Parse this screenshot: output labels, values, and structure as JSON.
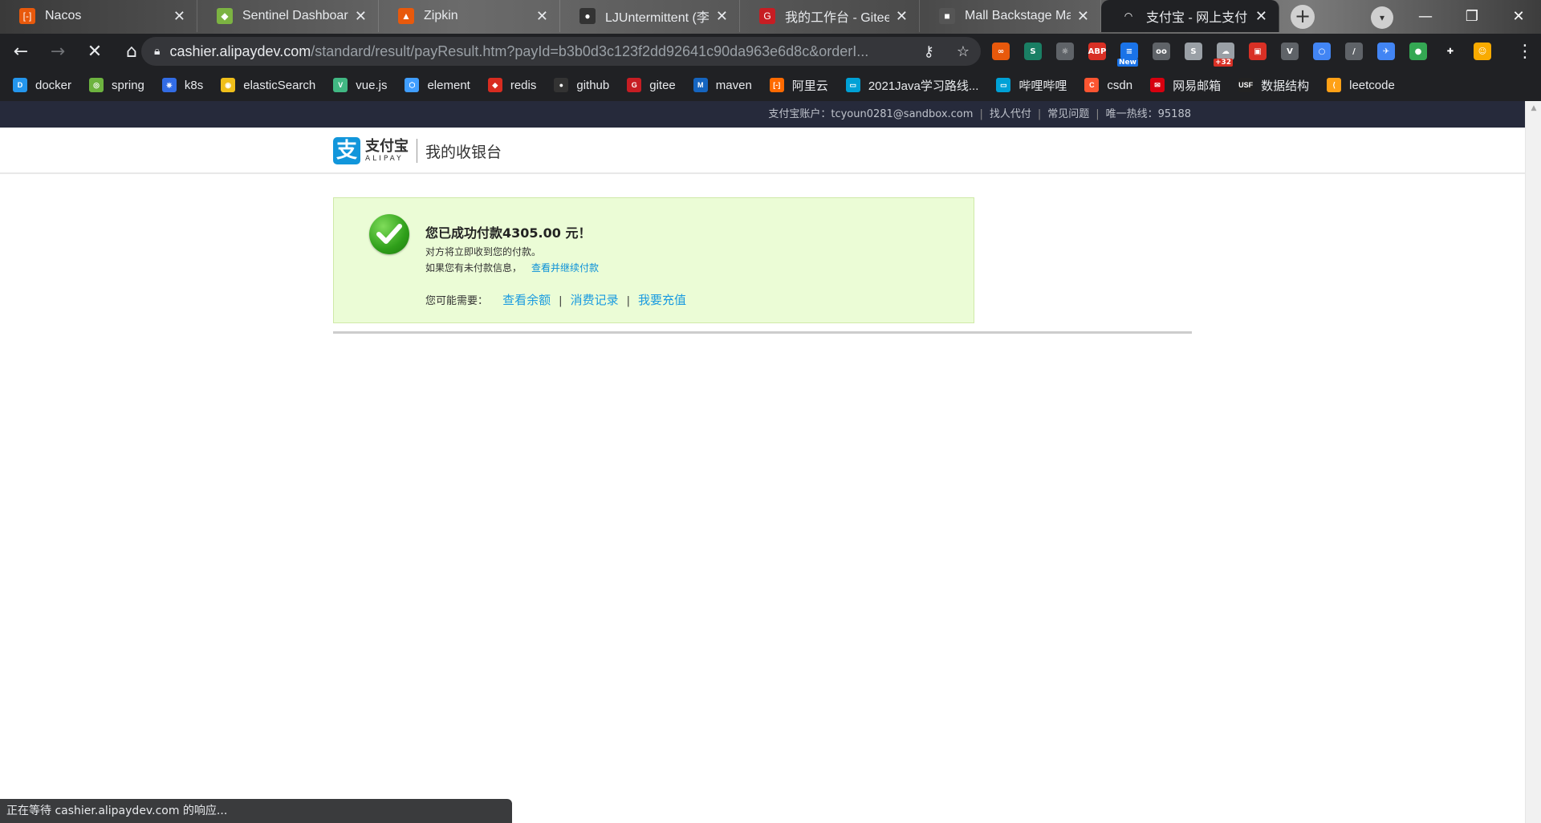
{
  "tabs": [
    {
      "title": "Nacos",
      "fav_color": "#e8590c",
      "fav_glyph": "[-]"
    },
    {
      "title": "Sentinel Dashboard",
      "fav_color": "#7cb342",
      "fav_glyph": "◆"
    },
    {
      "title": "Zipkin",
      "fav_color": "#e8590c",
      "fav_glyph": "▲"
    },
    {
      "title": "LJUntermittent (李佳",
      "fav_color": "#333333",
      "fav_glyph": "●"
    },
    {
      "title": "我的工作台 - Gitee.co",
      "fav_color": "#c71d23",
      "fav_glyph": "G"
    },
    {
      "title": "Mall Backstage Ma",
      "fav_color": "#555555",
      "fav_glyph": "■"
    },
    {
      "title": "支付宝 - 网上支付 安",
      "fav_color": "#202124",
      "fav_glyph": "◠"
    }
  ],
  "address": {
    "host": "cashier.alipaydev.com",
    "path": "/standard/result/payResult.htm?payId=b3b0d3c123f2dd92641c90da963e6d8c&orderI..."
  },
  "extensions": [
    {
      "name": "infinity-ext-icon",
      "color": "#e8590c",
      "glyph": "∞"
    },
    {
      "name": "s-ext-icon",
      "color": "#1a7f64",
      "glyph": "S"
    },
    {
      "name": "bulb-ext-icon",
      "color": "#5f6368",
      "glyph": "☼"
    },
    {
      "name": "adblock-plus-icon",
      "color": "#d93025",
      "glyph": "ABP"
    },
    {
      "name": "new-ext-icon",
      "color": "#1a73e8",
      "glyph": "≡",
      "badge": "New",
      "badge_color": "#1a73e8"
    },
    {
      "name": "glasses-ext-icon",
      "color": "#5f6368",
      "glyph": "oo"
    },
    {
      "name": "s-grey-ext-icon",
      "color": "#9aa0a6",
      "glyph": "S"
    },
    {
      "name": "weather-ext-icon",
      "color": "#9aa0a6",
      "glyph": "☁",
      "badge": "+32",
      "badge_color": "#d93025"
    },
    {
      "name": "rec-ext-icon",
      "color": "#d93025",
      "glyph": "▣"
    },
    {
      "name": "vue-devtools-icon",
      "color": "#5f6368",
      "glyph": "V"
    },
    {
      "name": "circle-ext-icon",
      "color": "#4285f4",
      "glyph": "○"
    },
    {
      "name": "dropper-ext-icon",
      "color": "#5f6368",
      "glyph": "/"
    },
    {
      "name": "bird-ext-icon",
      "color": "#4285f4",
      "glyph": "✈"
    },
    {
      "name": "green-dot-ext-icon",
      "color": "#34a853",
      "glyph": "●"
    },
    {
      "name": "puzzle-ext-icon",
      "color": "#202124",
      "glyph": "✚"
    },
    {
      "name": "profile-avatar-icon",
      "color": "#f9ab00",
      "glyph": "☺"
    }
  ],
  "bookmarks": [
    {
      "label": "docker",
      "color": "#2496ed",
      "glyph": "D"
    },
    {
      "label": "spring",
      "color": "#6db33f",
      "glyph": "◎"
    },
    {
      "label": "k8s",
      "color": "#326ce5",
      "glyph": "⎈"
    },
    {
      "label": "elasticSearch",
      "color": "#f0bf1a",
      "glyph": "◉"
    },
    {
      "label": "vue.js",
      "color": "#41b883",
      "glyph": "V"
    },
    {
      "label": "element",
      "color": "#409eff",
      "glyph": "⬡"
    },
    {
      "label": "redis",
      "color": "#d82c20",
      "glyph": "◆"
    },
    {
      "label": "github",
      "color": "#333333",
      "glyph": "●"
    },
    {
      "label": "gitee",
      "color": "#c71d23",
      "glyph": "G"
    },
    {
      "label": "maven",
      "color": "#1565c0",
      "glyph": "M"
    },
    {
      "label": "阿里云",
      "color": "#ff6a00",
      "glyph": "[-]"
    },
    {
      "label": "2021Java学习路线...",
      "color": "#00a1d6",
      "glyph": "▭"
    },
    {
      "label": "哔哩哔哩",
      "color": "#00a1d6",
      "glyph": "▭"
    },
    {
      "label": "csdn",
      "color": "#fc5531",
      "glyph": "C"
    },
    {
      "label": "网易邮箱",
      "color": "#d7000f",
      "glyph": "✉"
    },
    {
      "label": "数据结构",
      "color": "#222222",
      "glyph": "USF"
    },
    {
      "label": "leetcode",
      "color": "#ffa116",
      "glyph": "⟨"
    }
  ],
  "topbar": {
    "account": "支付宝账户：tcyoun0281@sandbox.com",
    "find_pay": "找人代付",
    "faq": "常见问题",
    "hotline": "唯一热线：95188"
  },
  "header": {
    "brand_cn": "支付宝",
    "brand_en": "ALIPAY",
    "title": "我的收银台"
  },
  "result": {
    "message": "您已成功付款4305.00 元！",
    "line1": "对方将立即收到您的付款。",
    "line2": "如果您有未付款信息，",
    "line2_link": "查看并继续付款",
    "maybe_label": "您可能需要：",
    "links": [
      "查看余额",
      "消费记录",
      "我要充值"
    ]
  },
  "status": "正在等待 cashier.alipaydev.com 的响应..."
}
